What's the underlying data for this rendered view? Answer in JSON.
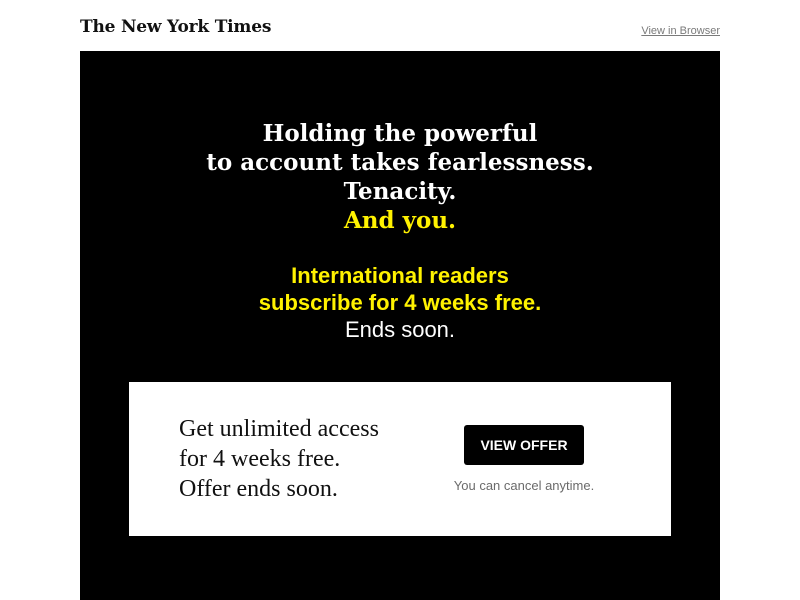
{
  "header": {
    "logo_text": "The New York Times",
    "view_in_browser": "View in Browser"
  },
  "hero": {
    "headline": [
      "Holding the powerful",
      "to account takes fearlessness.",
      "Tenacity."
    ],
    "headline_accent": "And you.",
    "promo_line_1": "International readers",
    "promo_line_2": "subscribe for 4 weeks free.",
    "promo_line_3": "Ends soon."
  },
  "offer": {
    "text": [
      "Get unlimited access",
      "for 4 weeks free.",
      "Offer ends soon."
    ],
    "button_label": "VIEW OFFER",
    "cancel_note": "You can cancel anytime."
  },
  "colors": {
    "hero_background": "#000000",
    "accent_yellow": "#fff200",
    "card_background": "#ffffff",
    "button_background": "#000000"
  }
}
